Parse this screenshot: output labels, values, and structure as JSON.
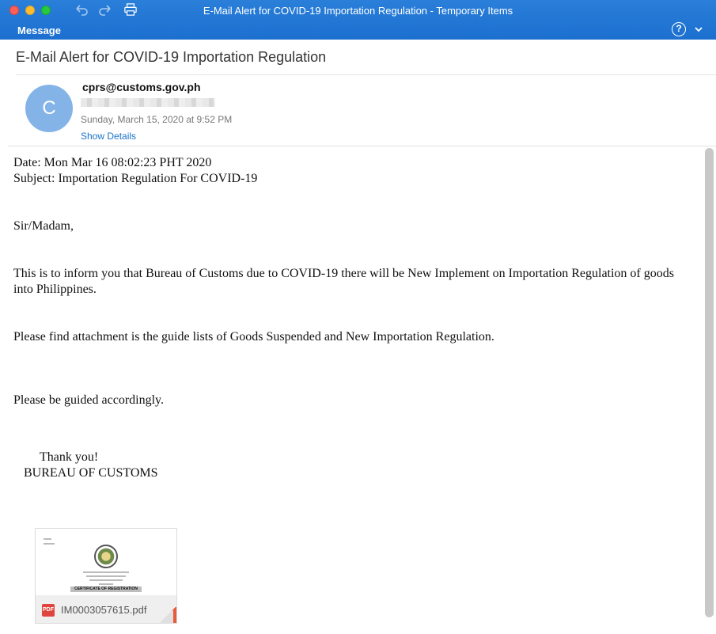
{
  "window": {
    "title": "E-Mail Alert for COVID-19 Importation Regulation - Temporary Items",
    "ribbon_tab": "Message",
    "help_label": "?"
  },
  "message": {
    "subject": "E-Mail Alert for COVID-19 Importation Regulation",
    "avatar_initial": "C",
    "sender": "cprs@customs.gov.ph",
    "sent": "Sunday, March 15, 2020 at 9:52 PM",
    "show_details": "Show Details"
  },
  "body": {
    "date_line": "Date: Mon Mar 16 08:02:23 PHT 2020",
    "subject_line": "Subject: Importation Regulation For COVID-19",
    "greeting": "Sir/Madam,",
    "paragraph1": "This is to inform you that Bureau of Customs due to COVID-19 there will be New Implement on Importation Regulation of goods into Philippines.",
    "paragraph2": "Please find attachment is the guide lists of Goods Suspended and New Importation Regulation.",
    "paragraph3": "Please be guided accordingly.",
    "thanks": "Thank you!",
    "signature": "BUREAU OF CUSTOMS"
  },
  "attachment": {
    "filename": "IM0003057615.pdf",
    "type_badge": "PDF",
    "preview_caption": "CERTIFICATE OF REGISTRATION"
  },
  "icons": [
    "undo-icon",
    "redo-icon",
    "print-icon",
    "help-icon",
    "chevron-down-icon",
    "pdf-icon"
  ],
  "colors": {
    "titlebar": "#1c6fcf",
    "avatar": "#84b4e7",
    "link": "#1a73c8",
    "pdf_badge": "#e0443e"
  }
}
